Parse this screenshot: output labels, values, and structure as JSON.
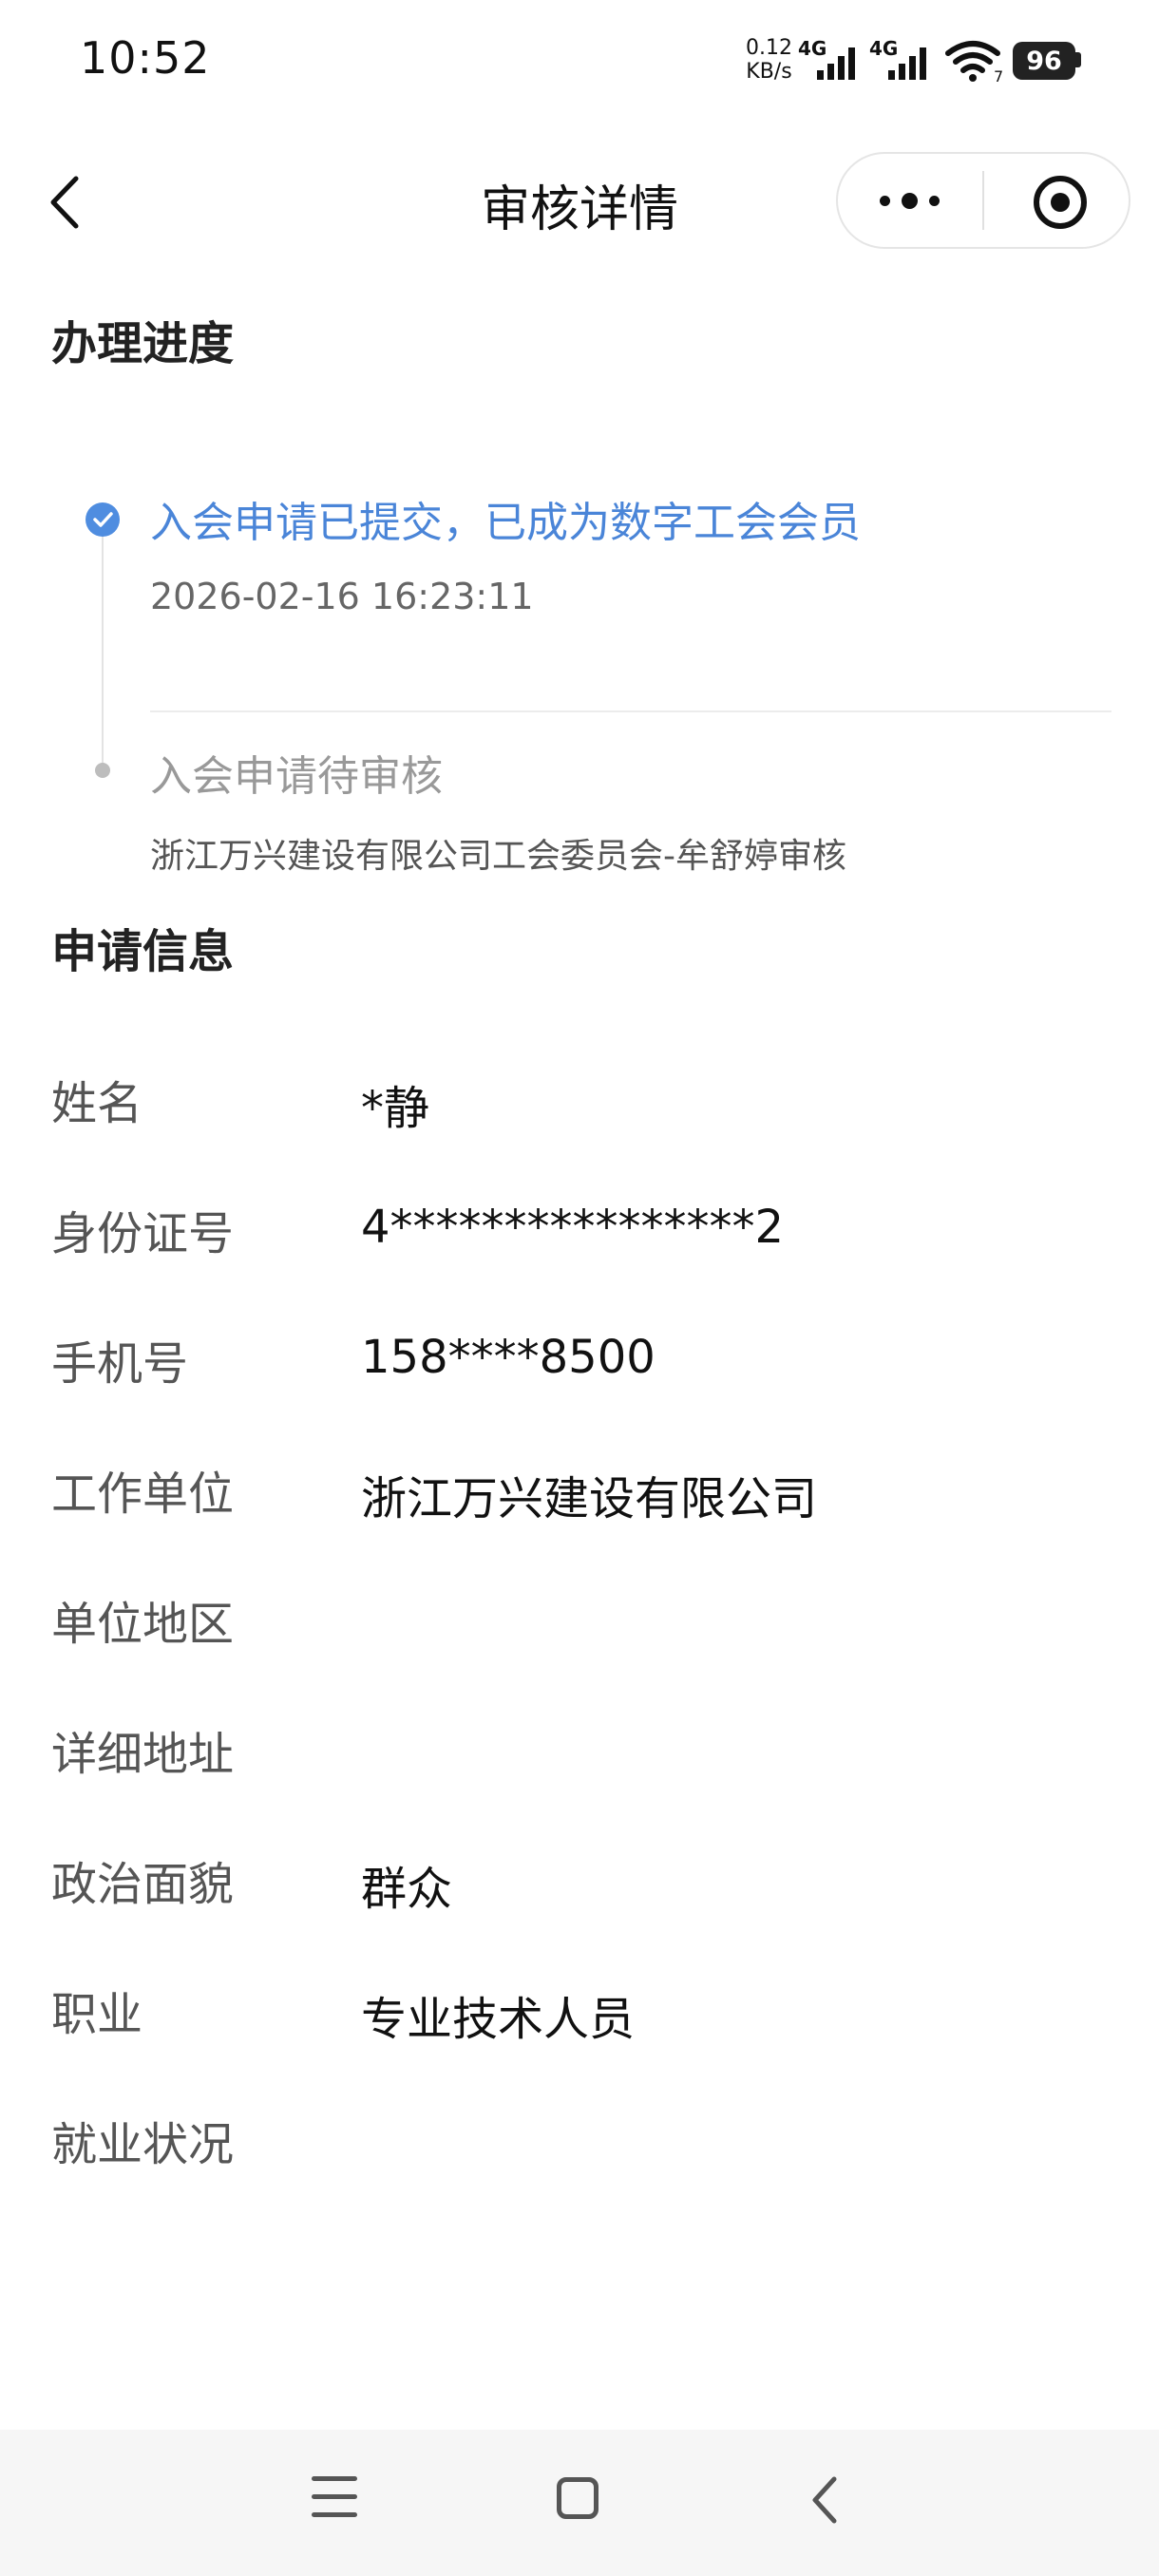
{
  "status_bar": {
    "time": "10:52",
    "net_speed_value": "0.12",
    "net_speed_unit": "KB/s",
    "network_1": "4G",
    "network_2": "4G",
    "wifi_sub": "7",
    "battery": "96",
    "icons": [
      "signal-icon",
      "signal-icon",
      "wifi-icon",
      "battery-icon"
    ]
  },
  "nav": {
    "title": "审核详情",
    "icons": [
      "back-arrow-icon",
      "more-dots-icon",
      "target-icon"
    ]
  },
  "progress": {
    "heading": "办理进度",
    "steps": [
      {
        "title": "入会申请已提交，已成为数字工会会员",
        "time": "2026-02-16 16:23:11",
        "status": "done",
        "color": "#4a85d8"
      },
      {
        "title": "入会申请待审核",
        "detail": "浙江万兴建设有限公司工会委员会-牟舒婷审核",
        "status": "pending",
        "color": "#999999"
      }
    ]
  },
  "application": {
    "heading": "申请信息",
    "fields": [
      {
        "label": "姓名",
        "value": "*静"
      },
      {
        "label": "身份证号",
        "value": "4****************2"
      },
      {
        "label": "手机号",
        "value": "158****8500"
      },
      {
        "label": "工作单位",
        "value": "浙江万兴建设有限公司"
      },
      {
        "label": "单位地区",
        "value": ""
      },
      {
        "label": "详细地址",
        "value": ""
      },
      {
        "label": "政治面貌",
        "value": "群众"
      },
      {
        "label": "职业",
        "value": "专业技术人员"
      },
      {
        "label": "就业状况",
        "value": ""
      }
    ]
  },
  "bottom_nav": {
    "icons": [
      "menu-icon",
      "home-icon",
      "back-icon"
    ]
  }
}
